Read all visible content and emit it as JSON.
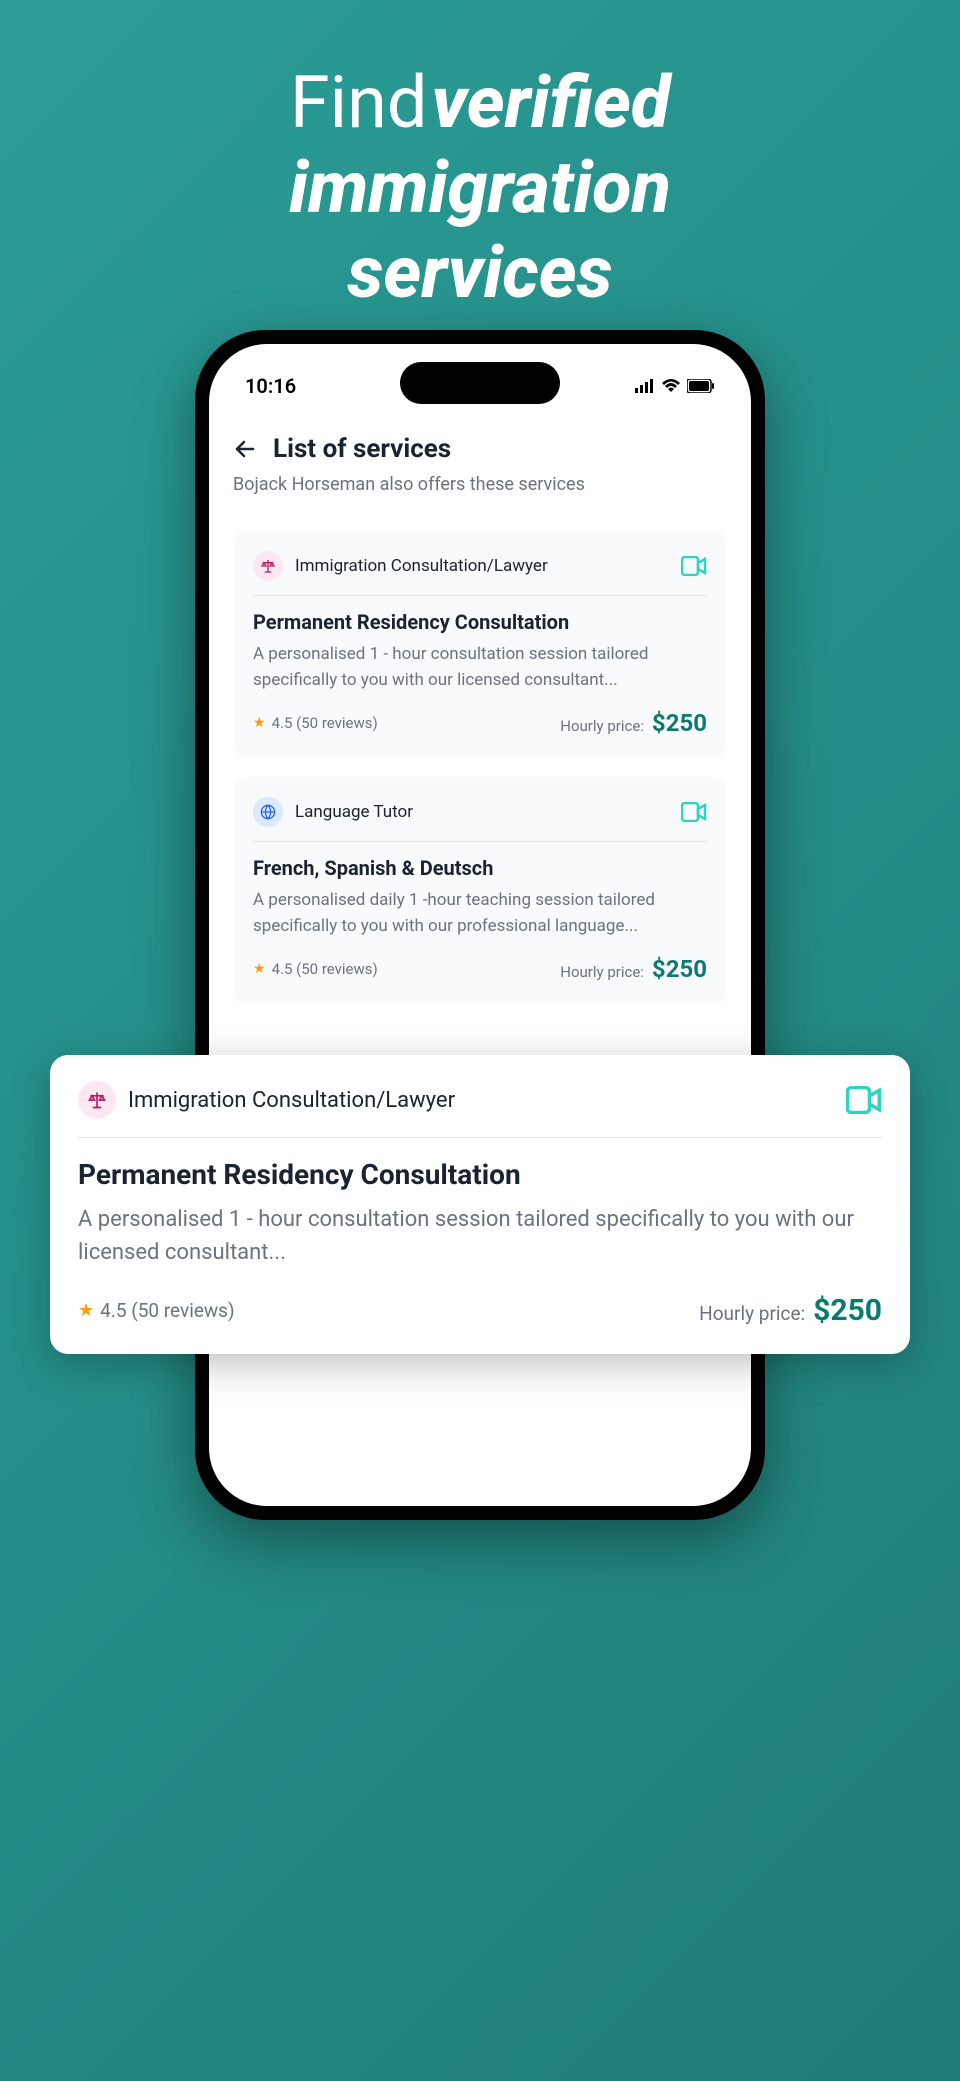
{
  "hero": {
    "line1_normal": "Find",
    "line1_bold": "verified",
    "line2": "immigration",
    "line3": "services"
  },
  "status": {
    "time": "10:16"
  },
  "page": {
    "title": "List of services",
    "subtitle": "Bojack Horseman also offers these services"
  },
  "cards": [
    {
      "category": "Immigration Consultation/Lawyer",
      "icon": "scales",
      "title": "Permanent Residency Consultation",
      "description": "A personalised 1 - hour consultation session tailored specifically to you with our licensed consultant...",
      "rating": "4.5 (50 reviews)",
      "price_label": "Hourly price:",
      "price": "$250"
    },
    {
      "category": "Language Tutor",
      "icon": "globe",
      "title": "French, Spanish & Deutsch",
      "description": "A personalised daily 1 -hour teaching session tailored specifically to you with our professional language...",
      "rating": "4.5 (50 reviews)",
      "price_label": "Hourly price:",
      "price": "$250"
    }
  ],
  "overlay": {
    "category": "Immigration Consultation/Lawyer",
    "icon": "scales",
    "title": "Permanent Residency Consultation",
    "description": "A personalised 1 - hour consultation session tailored specifically to you with our licensed consultant...",
    "rating": "4.5 (50 reviews)",
    "price_label": "Hourly price:",
    "price": "$250"
  }
}
